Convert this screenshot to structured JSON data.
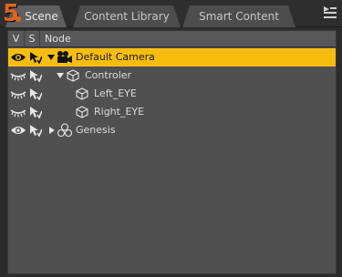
{
  "step_number": "5",
  "tabs": [
    {
      "label": "Scene",
      "active": true
    },
    {
      "label": "Content Library",
      "active": false
    },
    {
      "label": "Smart Content",
      "active": false
    }
  ],
  "columns": {
    "visible": "V",
    "selectable": "S",
    "node": "Node"
  },
  "nodes": [
    {
      "label": "Default Camera",
      "icon": "camera-icon",
      "expander": "expanded",
      "selected": true,
      "visible": "eye-open"
    },
    {
      "label": "Controler",
      "icon": "cube-icon",
      "expander": "expanded",
      "selected": false,
      "visible": "eye-closed"
    },
    {
      "label": "Left_EYE",
      "icon": "cube-icon",
      "expander": "none",
      "selected": false,
      "visible": "eye-closed"
    },
    {
      "label": "Right_EYE",
      "icon": "cube-icon",
      "expander": "none",
      "selected": false,
      "visible": "eye-closed"
    },
    {
      "label": "Genesis",
      "icon": "figure-icon",
      "expander": "collapsed",
      "selected": false,
      "visible": "eye-open"
    }
  ],
  "colors": {
    "selection": "#f6bd0f",
    "background": "#505050",
    "badge": "#e2631c"
  }
}
